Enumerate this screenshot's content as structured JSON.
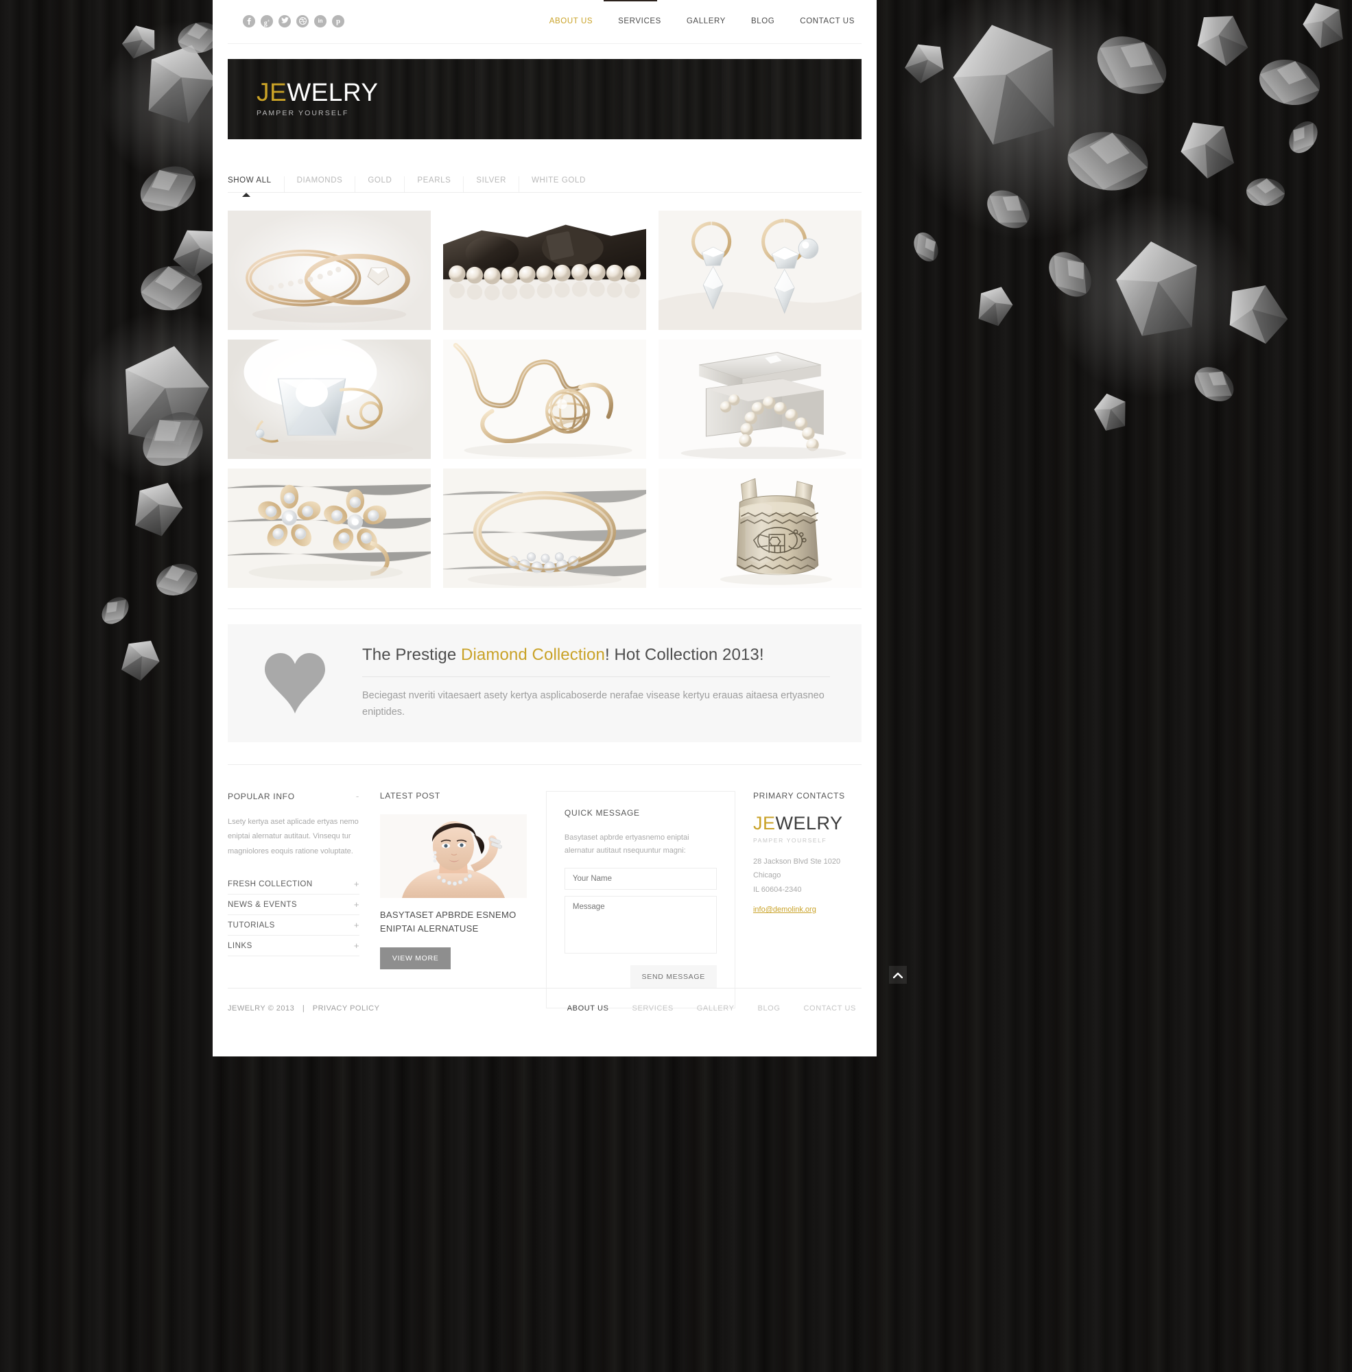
{
  "header": {
    "social": [
      {
        "name": "facebook",
        "glyph": "f"
      },
      {
        "name": "google-plus",
        "glyph": "g"
      },
      {
        "name": "twitter",
        "glyph": "t"
      },
      {
        "name": "dribbble",
        "glyph": "d"
      },
      {
        "name": "linkedin",
        "glyph": "in"
      },
      {
        "name": "pinterest",
        "glyph": "p"
      }
    ],
    "nav": [
      {
        "label": "ABOUT US",
        "active": true
      },
      {
        "label": "SERVICES",
        "active": false
      },
      {
        "label": "GALLERY",
        "active": false
      },
      {
        "label": "BLOG",
        "active": false
      },
      {
        "label": "CONTACT US",
        "active": false
      }
    ]
  },
  "hero": {
    "logo_first": "JE",
    "logo_rest": "WELRY",
    "tagline": "PAMPER YOURSELF"
  },
  "filters": [
    {
      "label": "SHOW ALL",
      "active": true
    },
    {
      "label": "DIAMONDS",
      "active": false
    },
    {
      "label": "GOLD",
      "active": false
    },
    {
      "label": "PEARLS",
      "active": false
    },
    {
      "label": "SILVER",
      "active": false
    },
    {
      "label": "WHITE GOLD",
      "active": false
    }
  ],
  "gallery": [
    {
      "alt": "gold-diamond-ring-pair"
    },
    {
      "alt": "pearl-necklace-with-dark-stones"
    },
    {
      "alt": "crystal-drop-earrings"
    },
    {
      "alt": "crystal-box-with-gold-chain"
    },
    {
      "alt": "gold-chain-with-caged-pearl-pendant"
    },
    {
      "alt": "silver-gift-box-with-pearls"
    },
    {
      "alt": "flower-shaped-diamond-earrings"
    },
    {
      "alt": "vintage-diamond-band-ring"
    },
    {
      "alt": "engraved-silver-cuff-bracelet"
    }
  ],
  "promo": {
    "title_plain_1": "The Prestige ",
    "title_gold": "Diamond Collection",
    "title_plain_2": "! Hot Collection 2013!",
    "text": "Beciegast nveriti vitaesaert asety kertya asplicaboserde nerafae visease kertyu erauas aitaesa ertyasneo eniptides.",
    "icon": "heart-icon"
  },
  "footer": {
    "popular": {
      "title": "POPULAR INFO",
      "toggle": "-",
      "text": "Lsety kertya aset aplicade ertyas nemo eniptai alernatur autitaut. Vinsequ tur magniolores eoquis ratione voluptate.",
      "accordion": [
        {
          "label": "FRESH COLLECTION",
          "toggle": "+"
        },
        {
          "label": "NEWS & EVENTS",
          "toggle": "+"
        },
        {
          "label": "TUTORIALS",
          "toggle": "+"
        },
        {
          "label": "LINKS",
          "toggle": "+"
        }
      ]
    },
    "latest": {
      "title": "LATEST POST",
      "image_alt": "woman-wearing-diamond-necklace",
      "post_title": "BASYTASET APBRDE ESNEMO ENIPTAI ALERNATUSE",
      "button": "VIEW MORE"
    },
    "quick": {
      "title": "QUICK MESSAGE",
      "text": "Basytaset apbrde ertyasnemo eniptai alernatur autitaut nsequuntur magni:",
      "name_placeholder": "Your Name",
      "name_value": "",
      "message_placeholder": "Message",
      "message_value": "",
      "button": "SEND MESSAGE"
    },
    "contacts": {
      "title": "PRIMARY CONTACTS",
      "logo_first": "JE",
      "logo_rest": "WELRY",
      "tagline": "PAMPER YOURSELF",
      "address_1": "28 Jackson Blvd Ste 1020",
      "address_2": "Chicago",
      "address_3": "IL 60604-2340",
      "email": "info@demolink.org"
    }
  },
  "bottom": {
    "copyright": "JEWELRY © 2013",
    "separator": "|",
    "privacy": "PRIVACY POLICY",
    "nav": [
      {
        "label": "ABOUT US",
        "active": true
      },
      {
        "label": "SERVICES",
        "active": false
      },
      {
        "label": "GALLERY",
        "active": false
      },
      {
        "label": "BLOG",
        "active": false
      },
      {
        "label": "CONTACT US",
        "active": false
      }
    ]
  },
  "colors": {
    "gold": "#c9a227",
    "page": "#ffffff",
    "wood": "#141312",
    "promo_bg": "#f7f7f7"
  },
  "scroll_top": {
    "icon": "chevron-up-icon"
  }
}
